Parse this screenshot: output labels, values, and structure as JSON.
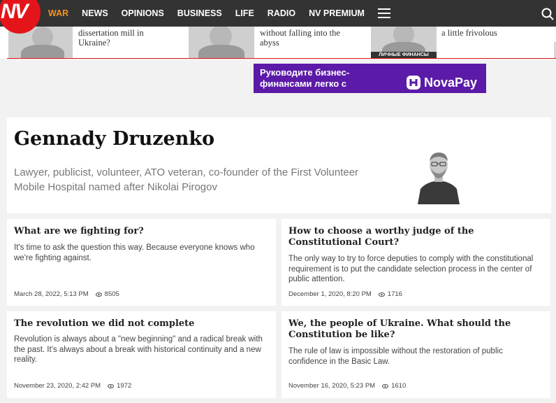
{
  "logo": "NV",
  "nav": {
    "items": [
      "WAR",
      "NEWS",
      "OPINIONS",
      "BUSINESS",
      "LIFE",
      "RADIO",
      "NV PREMIUM"
    ],
    "active": "WAR"
  },
  "strip": {
    "items": [
      {
        "text": "dissertation mill in Ukraine?"
      },
      {
        "text": "without falling into the abyss"
      },
      {
        "text": "a little frivolous"
      }
    ],
    "tag": "ЛИЧНЫЕ ФИНАНСЫ"
  },
  "ad": {
    "text": "Руководите бизнес-финансами легко с",
    "brand": "NovaPay",
    "color": "#5b1aa8"
  },
  "author": {
    "name": "Gennady Druzenko",
    "bio": "Lawyer, publicist, volunteer, ATO veteran, co-founder of the First Volunteer Mobile Hospital named after Nikolai Pirogov"
  },
  "articles": [
    {
      "title": "What are we fighting for?",
      "excerpt": "It's time to ask the question this way. Because everyone knows who we're fighting against.",
      "date": "March 28, 2022, 5:13 PM",
      "views": "8505"
    },
    {
      "title": "How to choose a worthy judge of the Constitutional Court?",
      "excerpt": "The only way to try to force deputies to comply with the constitutional requirement is to put the candidate selection process in the center of public attention.",
      "date": "December 1, 2020, 8:20 PM",
      "views": "1716"
    },
    {
      "title": "The revolution we did not complete",
      "excerpt": "Revolution is always about a \"new beginning\" and a radical break with the past. It's always about a break with historical continuity and a new reality.",
      "date": "November 23, 2020, 2:42 PM",
      "views": "1972"
    },
    {
      "title": "We, the people of Ukraine. What should the Constitution be like?",
      "excerpt": "The rule of law is impossible without the restoration of public confidence in the Basic Law.",
      "date": "November 16, 2020, 5:23 PM",
      "views": "1610"
    }
  ],
  "colors": {
    "brand_red": "#e3151a",
    "nav_bg": "#333333",
    "active_nav": "#f7941d"
  }
}
